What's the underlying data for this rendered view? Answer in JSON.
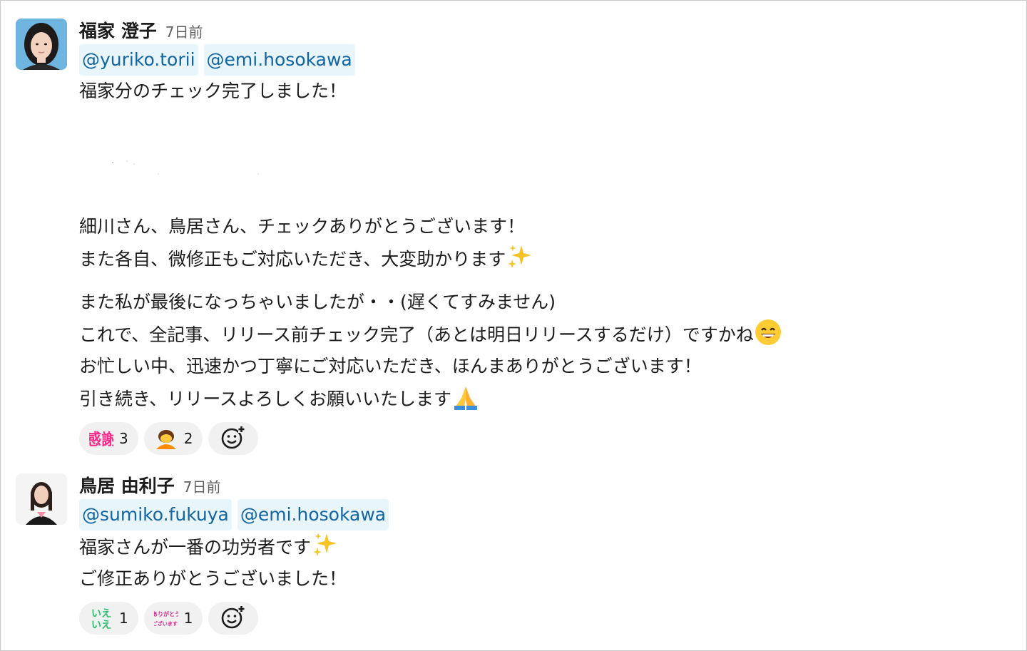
{
  "messages": [
    {
      "author": "福家 澄子",
      "time": "7日前",
      "mentions": [
        "@yuriko.torii",
        "@emi.hosokawa"
      ],
      "lines": [
        "福家分のチェック完了しました！",
        "細川さん、鳥居さん、チェックありがとうございます！",
        "また各自、微修正もご対応いただき、大変助かります",
        "また私が最後になっちゃいましたが・・(遅くてすみません)",
        "これで、全記事、リリース前チェック完了（あとは明日リリースするだけ）ですかね",
        "お忙しい中、迅速かつ丁寧にご対応いただき、ほんまありがとうございます！",
        "引き続き、リリースよろしくお願いいたします"
      ],
      "reactions": [
        {
          "emoji": "kansha-stamp",
          "text": "感謝",
          "count": "3"
        },
        {
          "emoji": "bowing-person-icon",
          "count": "2"
        }
      ],
      "inline_emojis": [
        "sparkles-icon",
        "grinning-face-icon",
        "folded-hands-icon"
      ]
    },
    {
      "author": "鳥居 由利子",
      "time": "7日前",
      "mentions": [
        "@sumiko.fukuya",
        "@emi.hosokawa"
      ],
      "lines": [
        "福家さんが一番の功労者です",
        "ご修正ありがとうございました！"
      ],
      "reactions": [
        {
          "emoji": "iie-iie-stamp",
          "text_top": "いえ",
          "text_bottom": "いえ",
          "count": "1"
        },
        {
          "emoji": "arigatou-stamp",
          "text_top": "ありがとう",
          "text_bottom": "ございます!",
          "count": "1"
        }
      ],
      "inline_emojis": [
        "sparkles-icon"
      ]
    }
  ],
  "colors": {
    "mention_bg": "#e8f5fa",
    "mention_text": "#1264a3",
    "reaction_bg": "#f1f1f1",
    "timestamp": "#616061"
  }
}
